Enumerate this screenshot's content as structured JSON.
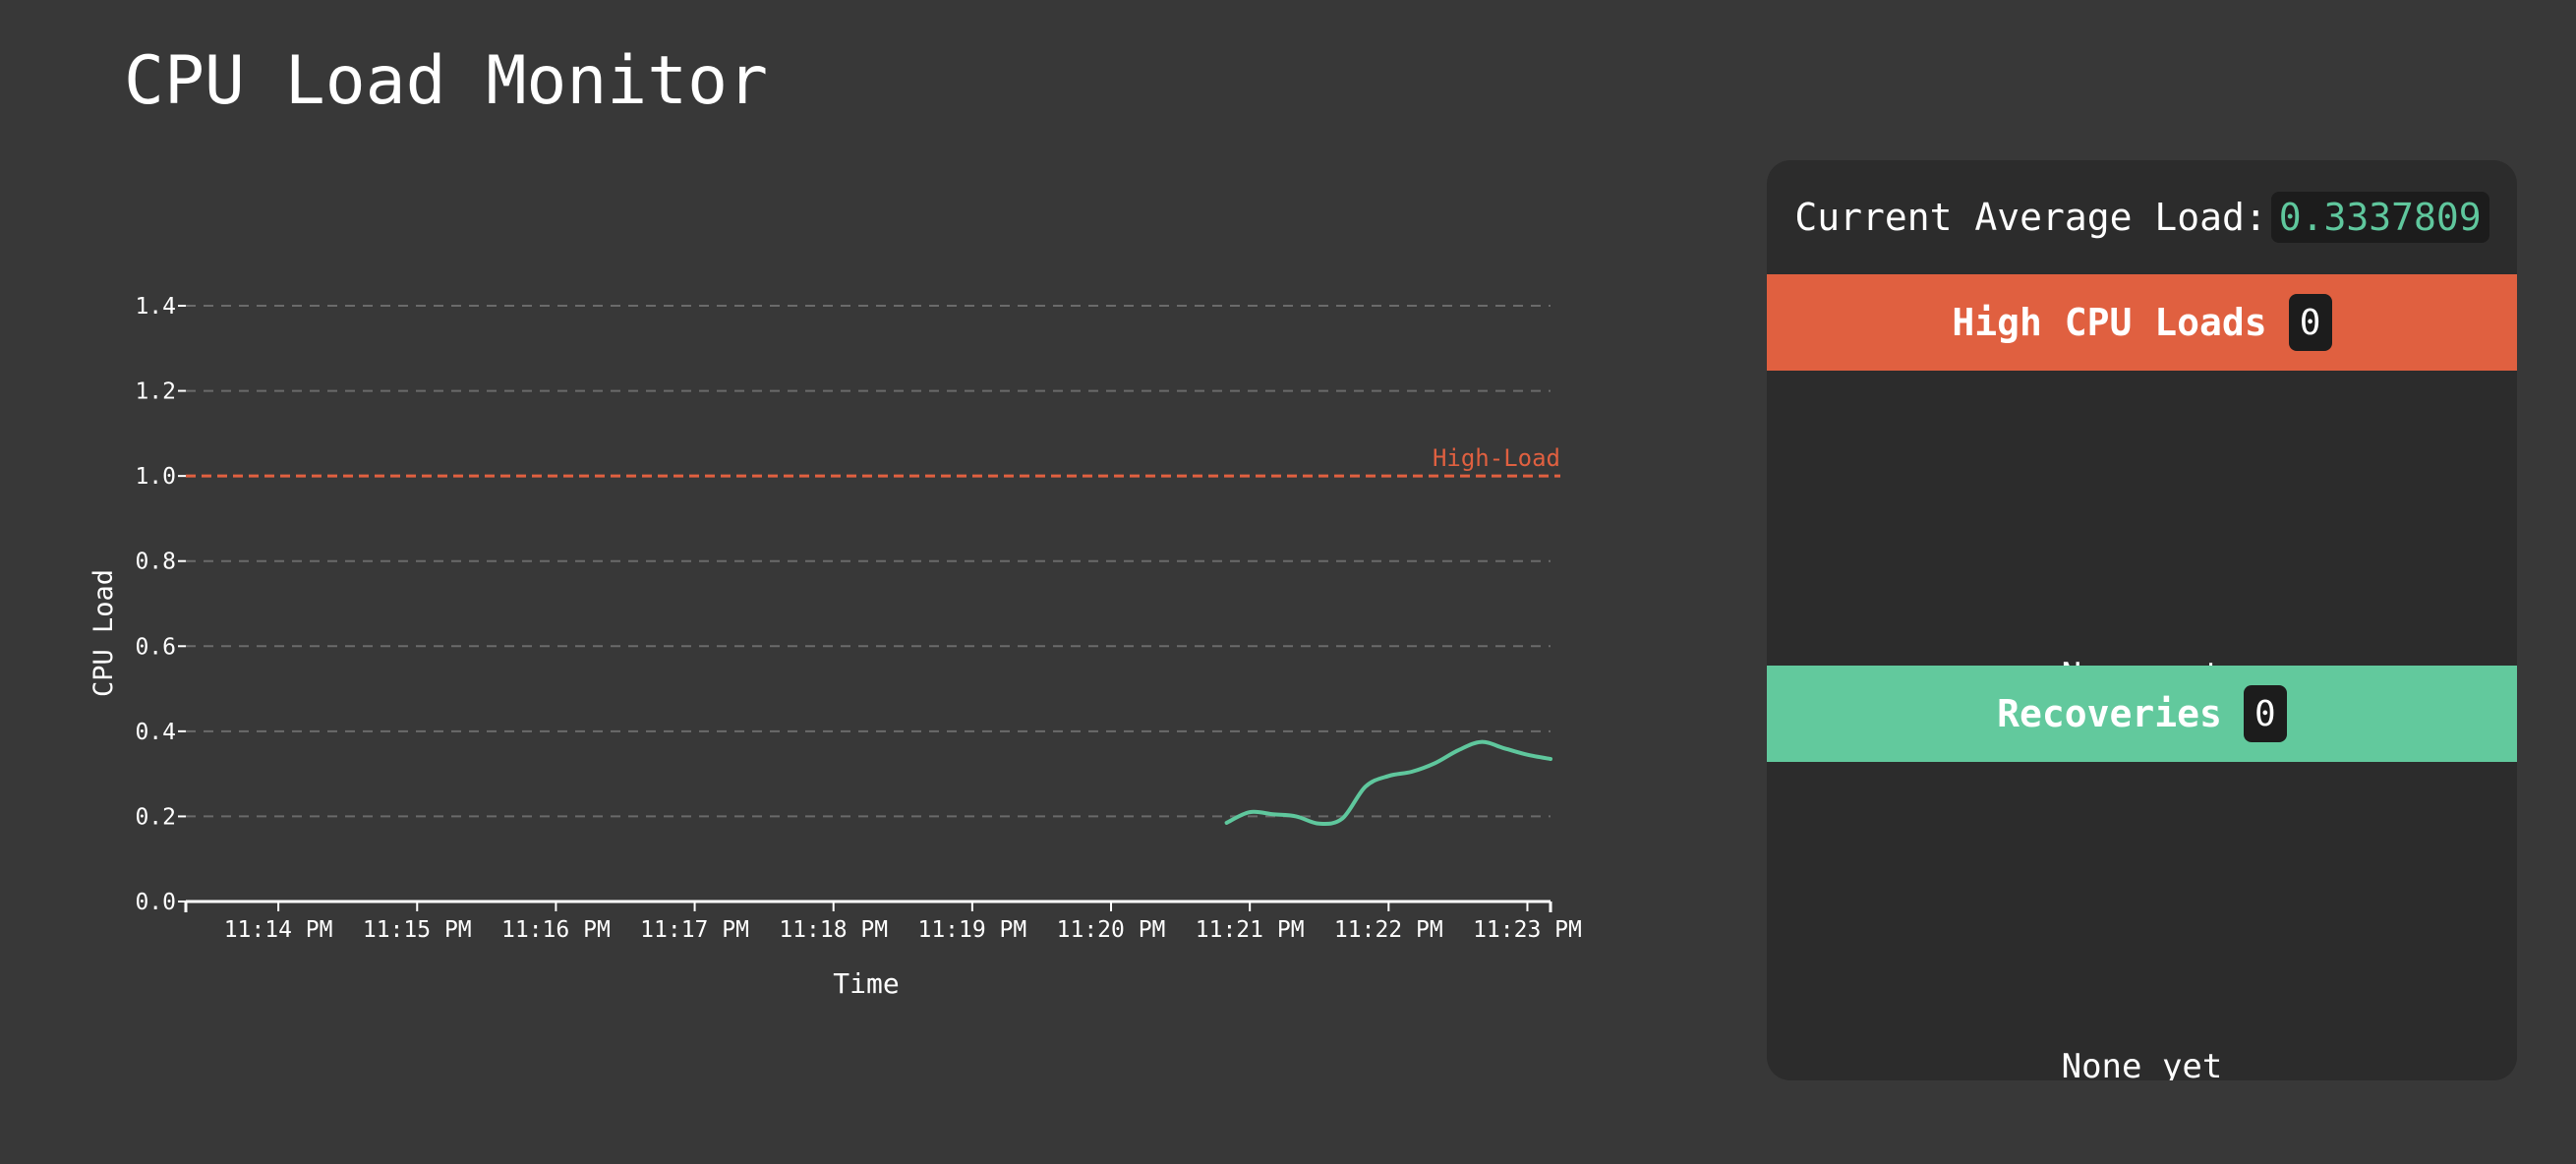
{
  "page": {
    "title": "CPU Load Monitor"
  },
  "colors": {
    "background": "#383838",
    "panel": "#2c2c2c",
    "high": "#e06040",
    "recovery": "#62c99d",
    "line": "#5fc79d",
    "grid": "#6a6a6a"
  },
  "status": {
    "avg_label": "Current Average Load:",
    "avg_value": "0.3337809"
  },
  "high_loads": {
    "title": "High CPU Loads",
    "count": "0",
    "empty_text": "None yet"
  },
  "recoveries": {
    "title": "Recoveries",
    "count": "0",
    "empty_text": "None yet"
  },
  "chart_data": {
    "type": "line",
    "xlabel": "Time",
    "ylabel": "CPU Load",
    "ylim": [
      0,
      1.4
    ],
    "yticks": [
      "0.0",
      "0.2",
      "0.4",
      "0.6",
      "0.8",
      "1.0",
      "1.2",
      "1.4"
    ],
    "xlim": [
      "11:13:20 PM",
      "11:23:10 PM"
    ],
    "xticks": [
      "11:14 PM",
      "11:15 PM",
      "11:16 PM",
      "11:17 PM",
      "11:18 PM",
      "11:19 PM",
      "11:20 PM",
      "11:21 PM",
      "11:22 PM",
      "11:23 PM"
    ],
    "grid": true,
    "threshold": {
      "value": 1.0,
      "label": "High-Load"
    },
    "series": [
      {
        "x": [
          "11:20:50 PM",
          "11:21:00 PM",
          "11:21:10 PM",
          "11:21:20 PM",
          "11:21:30 PM",
          "11:21:40 PM",
          "11:21:50 PM",
          "11:22:00 PM",
          "11:22:10 PM",
          "11:22:20 PM",
          "11:22:30 PM",
          "11:22:40 PM",
          "11:22:50 PM",
          "11:23:00 PM",
          "11:23:10 PM"
        ],
        "values": [
          0.185,
          0.21,
          0.205,
          0.2,
          0.183,
          0.195,
          0.27,
          0.295,
          0.305,
          0.325,
          0.355,
          0.375,
          0.36,
          0.345,
          0.335
        ]
      }
    ]
  }
}
